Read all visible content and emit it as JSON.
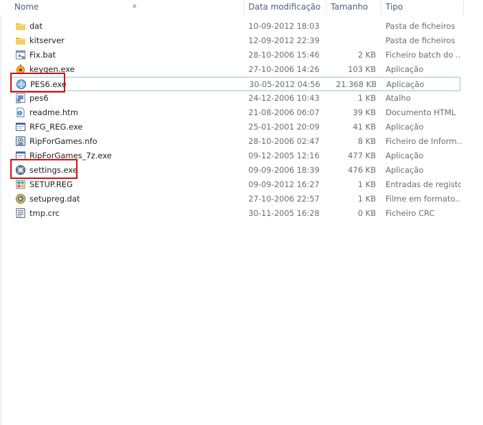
{
  "columns": {
    "name": "Nome",
    "date": "Data modificação",
    "size": "Tamanho",
    "type": "Tipo"
  },
  "files": [
    {
      "name": "dat",
      "date": "10-09-2012 18:03",
      "size": "",
      "type": "Pasta de ficheiros",
      "icon": "folder-icon"
    },
    {
      "name": "kitserver",
      "date": "12-09-2012 22:39",
      "size": "",
      "type": "Pasta de ficheiros",
      "icon": "folder-icon"
    },
    {
      "name": "Fix.bat",
      "date": "28-10-2006 15:46",
      "size": "2 KB",
      "type": "Ficheiro batch do ...",
      "icon": "batch-file-icon"
    },
    {
      "name": "keygen.exe",
      "date": "27-10-2006 14:26",
      "size": "103 KB",
      "type": "Aplicação",
      "icon": "keygen-app-icon"
    },
    {
      "name": "PES6.exe",
      "date": "30-05-2012 04:56",
      "size": "21.368 KB",
      "type": "Aplicação",
      "icon": "pes6-app-icon"
    },
    {
      "name": "pes6",
      "date": "24-12-2006 10:43",
      "size": "1 KB",
      "type": "Atalho",
      "icon": "shortcut-icon"
    },
    {
      "name": "readme.htm",
      "date": "21-08-2006 06:07",
      "size": "39 KB",
      "type": "Documento HTML",
      "icon": "html-document-icon"
    },
    {
      "name": "RFG_REG.exe",
      "date": "25-01-2001 20:09",
      "size": "41 KB",
      "type": "Aplicação",
      "icon": "window-app-icon"
    },
    {
      "name": "RipForGames.nfo",
      "date": "28-10-2006 02:47",
      "size": "8 KB",
      "type": "Ficheiro de Inform...",
      "icon": "nfo-file-icon"
    },
    {
      "name": "RipForGames_7z.exe",
      "date": "09-12-2005 12:16",
      "size": "477 KB",
      "type": "Aplicação",
      "icon": "window-app-icon"
    },
    {
      "name": "settings.exe",
      "date": "09-09-2006 18:39",
      "size": "476 KB",
      "type": "Aplicação",
      "icon": "settings-app-icon"
    },
    {
      "name": "SETUP.REG",
      "date": "09-09-2012 16:27",
      "size": "1 KB",
      "type": "Entradas de registo",
      "icon": "registry-file-icon"
    },
    {
      "name": "setupreg.dat",
      "date": "27-10-2006 22:57",
      "size": "1 KB",
      "type": "Filme em formato...",
      "icon": "media-file-icon"
    },
    {
      "name": "tmp.crc",
      "date": "30-11-2005 16:28",
      "size": "0 KB",
      "type": "Ficheiro CRC",
      "icon": "crc-file-icon"
    }
  ],
  "selected_index": 4,
  "highlighted_indices": [
    4,
    10
  ],
  "colors": {
    "highlight": "#d10c0c",
    "selection_border": "#a4bed7",
    "folder": "#f2c14e"
  }
}
